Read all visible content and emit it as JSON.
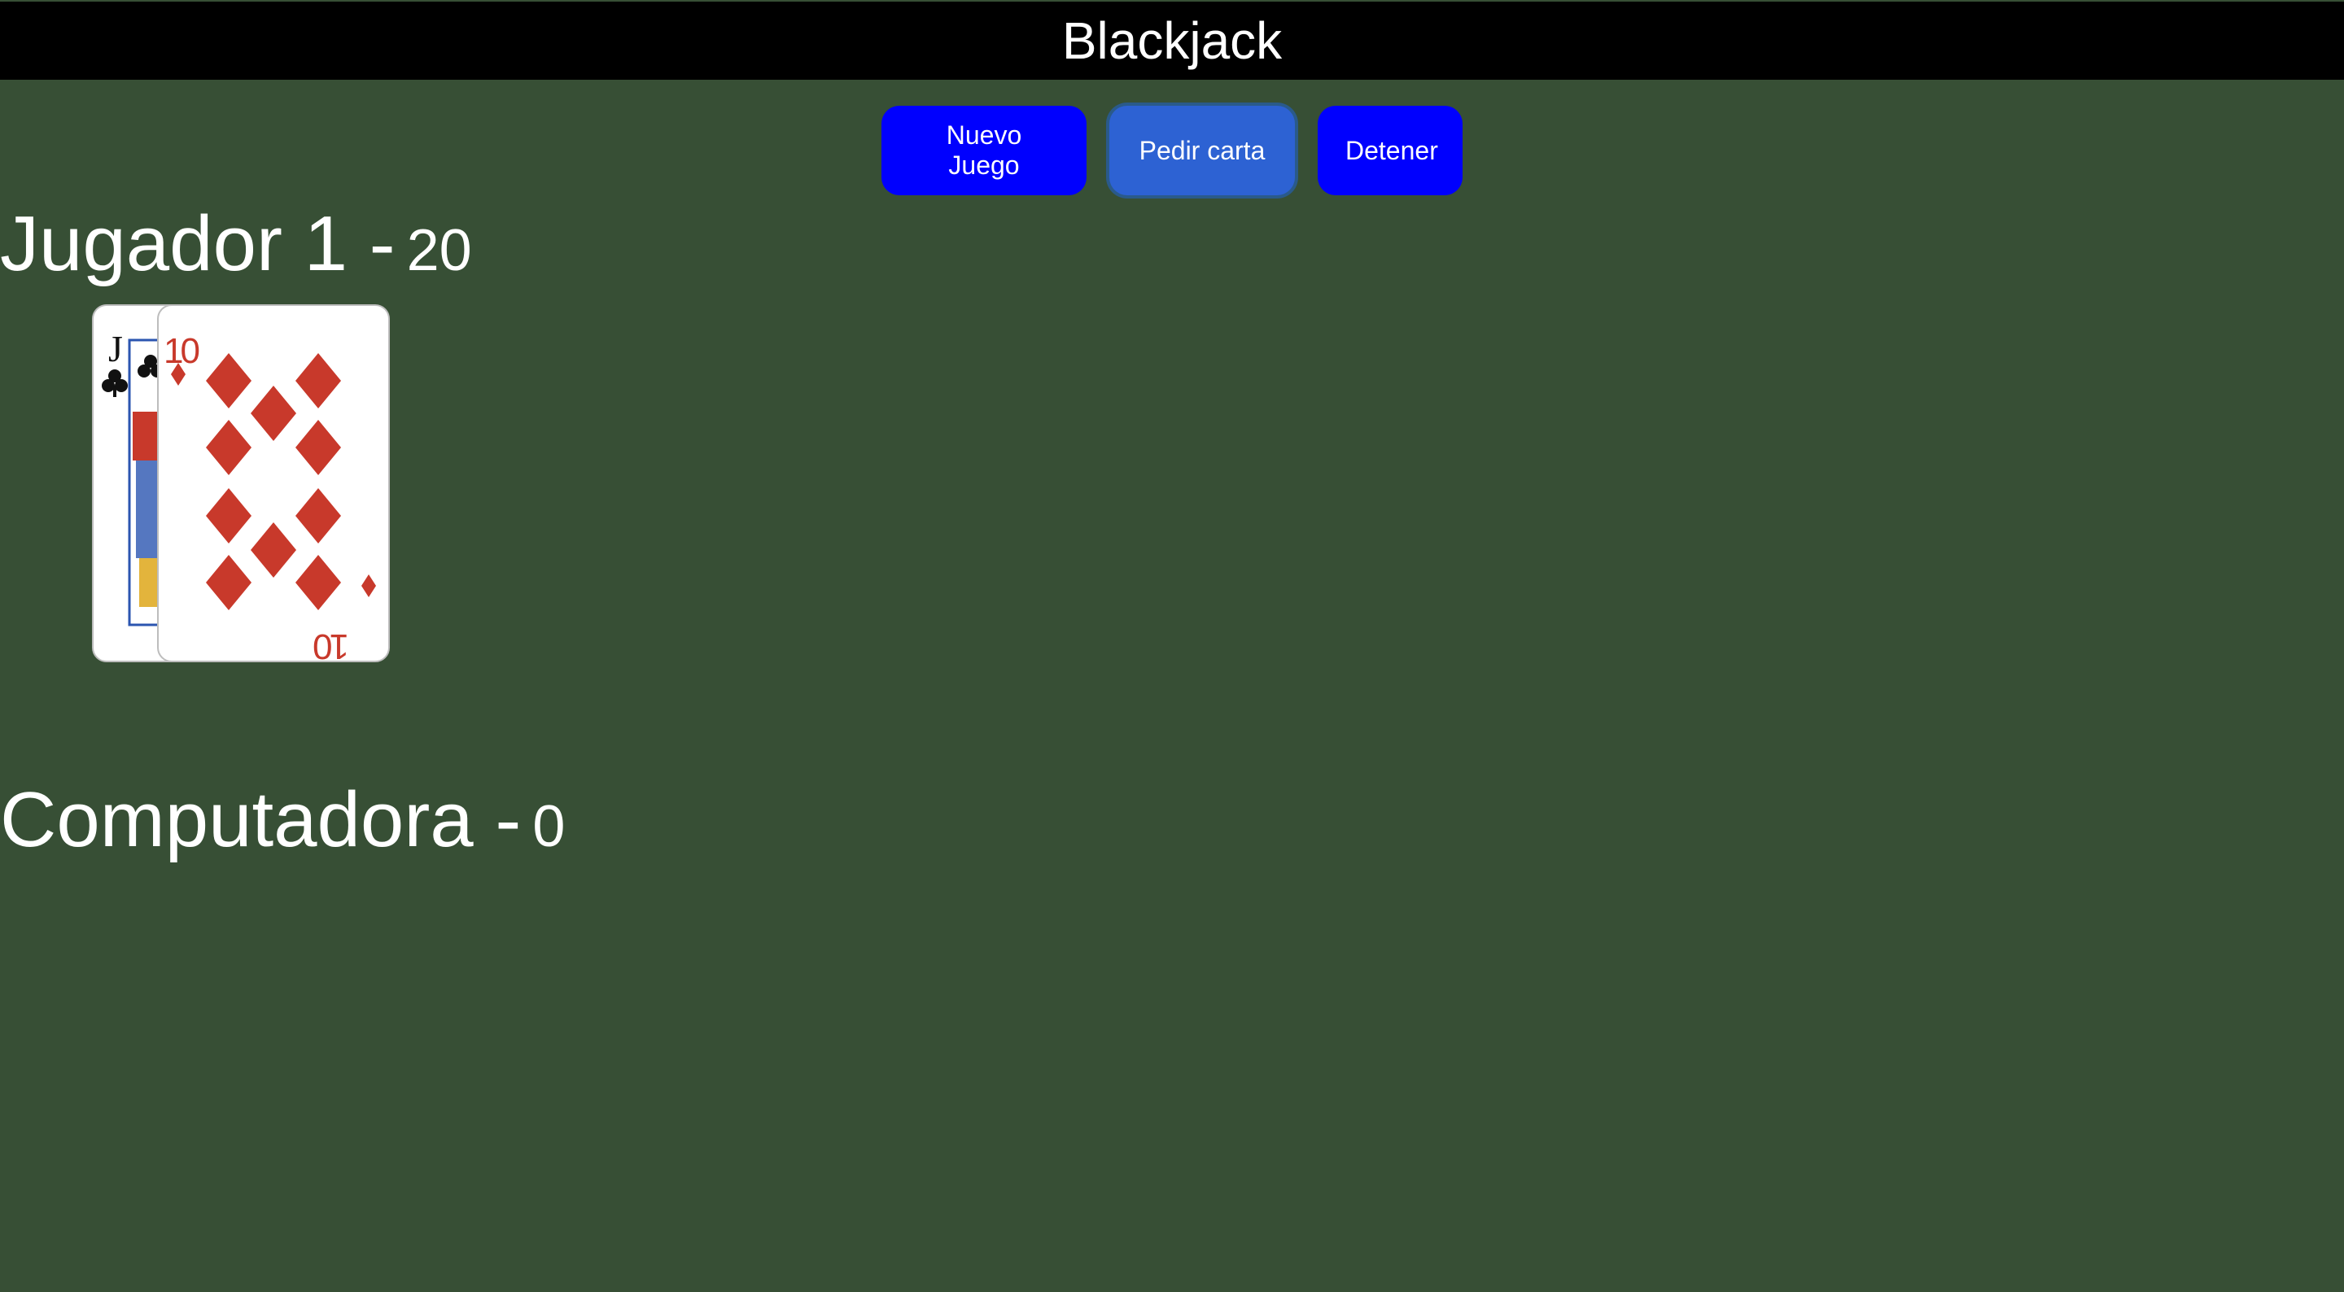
{
  "header": {
    "title": "Blackjack"
  },
  "buttons": {
    "new_game": "Nuevo Juego",
    "hit": "Pedir carta",
    "stand": "Detener"
  },
  "player": {
    "title": "Jugador 1 -",
    "score": "20",
    "cards": [
      {
        "rank": "J",
        "suit": "clubs",
        "color": "#111111"
      },
      {
        "rank": "10",
        "suit": "diamonds",
        "color": "#c8392b"
      }
    ]
  },
  "computer": {
    "title": "Computadora -",
    "score": "0",
    "cards": []
  },
  "colors": {
    "table_bg": "#374f35",
    "header_bg": "#000000",
    "button_bg": "#0000fe",
    "button_active_bg": "#2d62d3",
    "diamond_red": "#c8392b"
  }
}
